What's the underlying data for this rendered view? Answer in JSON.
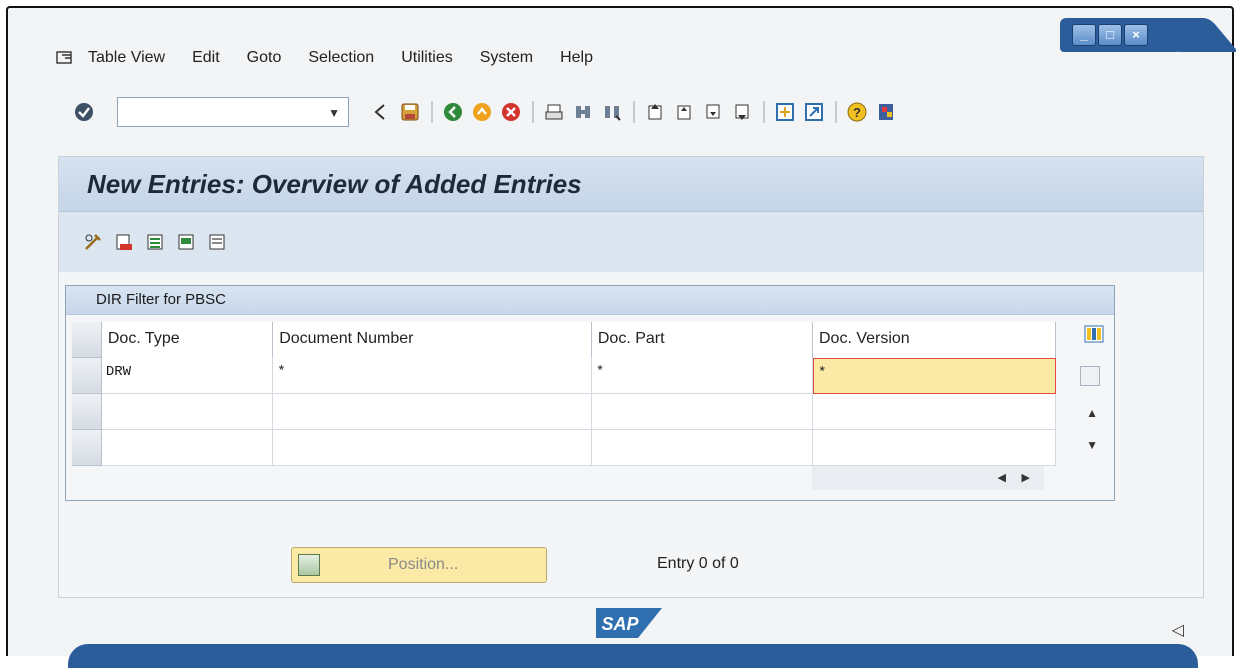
{
  "window": {
    "minimize_label": "_",
    "maximize_label": "□",
    "close_label": "×"
  },
  "menubar": {
    "items": [
      {
        "label": "Table View"
      },
      {
        "label": "Edit"
      },
      {
        "label": "Goto"
      },
      {
        "label": "Selection"
      },
      {
        "label": "Utilities"
      },
      {
        "label": "System"
      },
      {
        "label": "Help"
      }
    ]
  },
  "toolbar": {
    "command_field_value": "",
    "icons": [
      "enter-icon",
      "back-nav-icon",
      "save-icon",
      "back-icon",
      "exit-icon",
      "cancel-icon",
      "print-icon",
      "find-icon",
      "find-next-icon",
      "first-page-icon",
      "previous-page-icon",
      "next-page-icon",
      "last-page-icon",
      "create-session-icon",
      "shortcut-icon",
      "help-icon",
      "layout-menu-icon"
    ]
  },
  "page": {
    "title": "New Entries: Overview of Added Entries"
  },
  "app_toolbar": {
    "icons": [
      "change-display-icon",
      "delete-icon",
      "select-all-icon",
      "select-block-icon",
      "deselect-all-icon"
    ]
  },
  "table": {
    "title": "DIR Filter for PBSC",
    "columns": [
      "Doc. Type",
      "Document Number",
      "Doc. Part",
      "Doc. Version"
    ],
    "rows": [
      [
        "DRW",
        "*",
        "*",
        "*"
      ],
      [
        "",
        "",
        "",
        ""
      ],
      [
        "",
        "",
        "",
        ""
      ]
    ],
    "scroll_up": "▲",
    "scroll_down": "▼",
    "scroll_left": "◀",
    "scroll_right": "▶"
  },
  "footer": {
    "position_button_label": "Position...",
    "entry_info": "Entry 0 of 0",
    "sap_logo_text": "SAP"
  },
  "colors": {
    "accent": "#2a5d9a",
    "header_bg": "#c4d5e8",
    "highlight_cell": "#fbeaa6",
    "highlight_border": "#e34848"
  }
}
